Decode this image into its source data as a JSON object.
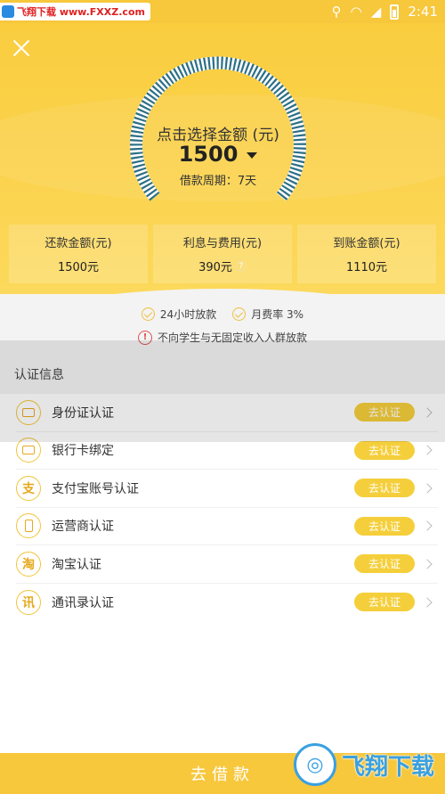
{
  "watermark_top": "飞翔下载 www.FXXZ.com",
  "status_bar": {
    "time": "2:41"
  },
  "dial": {
    "title": "点击选择金额 (元)",
    "amount": "1500",
    "period": "借款周期：7天",
    "ring_color": "#2b6f86"
  },
  "summary": [
    {
      "label": "还款金额(元)",
      "value": "1500元"
    },
    {
      "label": "利息与费用(元)",
      "value": "390元"
    },
    {
      "label": "到账金额(元)",
      "value": "1110元"
    }
  ],
  "notes": {
    "badge1": "24小时放款",
    "badge2": "月费率 3%",
    "warning": "不向学生与无固定收入人群放款"
  },
  "verify": {
    "header": "认证信息",
    "items": [
      {
        "label": "身份证认证",
        "button": "去认证",
        "icon": "id-card-icon"
      },
      {
        "label": "银行卡绑定",
        "button": "去认证",
        "icon": "bank-card-icon"
      },
      {
        "label": "支付宝账号认证",
        "button": "去认证",
        "icon": "alipay-icon"
      },
      {
        "label": "运营商认证",
        "button": "去认证",
        "icon": "phone-icon"
      },
      {
        "label": "淘宝认证",
        "button": "去认证",
        "icon": "taobao-icon"
      },
      {
        "label": "通讯录认证",
        "button": "去认证",
        "icon": "contacts-icon"
      }
    ]
  },
  "footer": {
    "button": "去借款",
    "watermark": "飞翔下载"
  },
  "colors": {
    "accent": "#f7c73c",
    "button": "#f5cf3b"
  }
}
